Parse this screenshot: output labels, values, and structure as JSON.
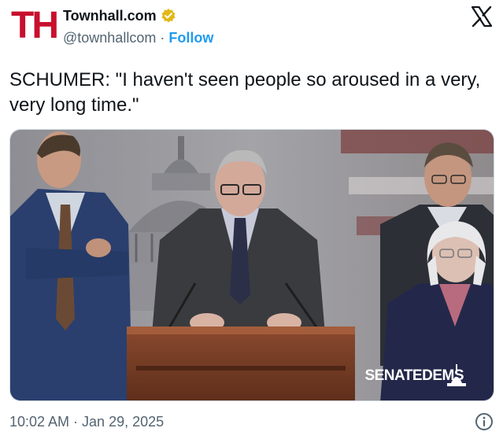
{
  "author": {
    "avatar_text": "TH",
    "display_name": "Townhall.com",
    "handle": "@townhallcom",
    "separator": "·",
    "follow_label": "Follow"
  },
  "tweet": {
    "text": "SCHUMER: \"I haven't seen people so aroused in a very, very long time.\"",
    "timestamp": "10:02 AM · Jan 29, 2025"
  },
  "media": {
    "watermark": "SENATEDEMS"
  },
  "icons": {
    "verified": "verified-badge-icon",
    "platform": "x-logo-icon",
    "info": "info-icon"
  },
  "colors": {
    "avatar_red": "#c8102e",
    "link_blue": "#1d9bf0",
    "verified_gold": "#e2b719",
    "muted": "#536471"
  }
}
